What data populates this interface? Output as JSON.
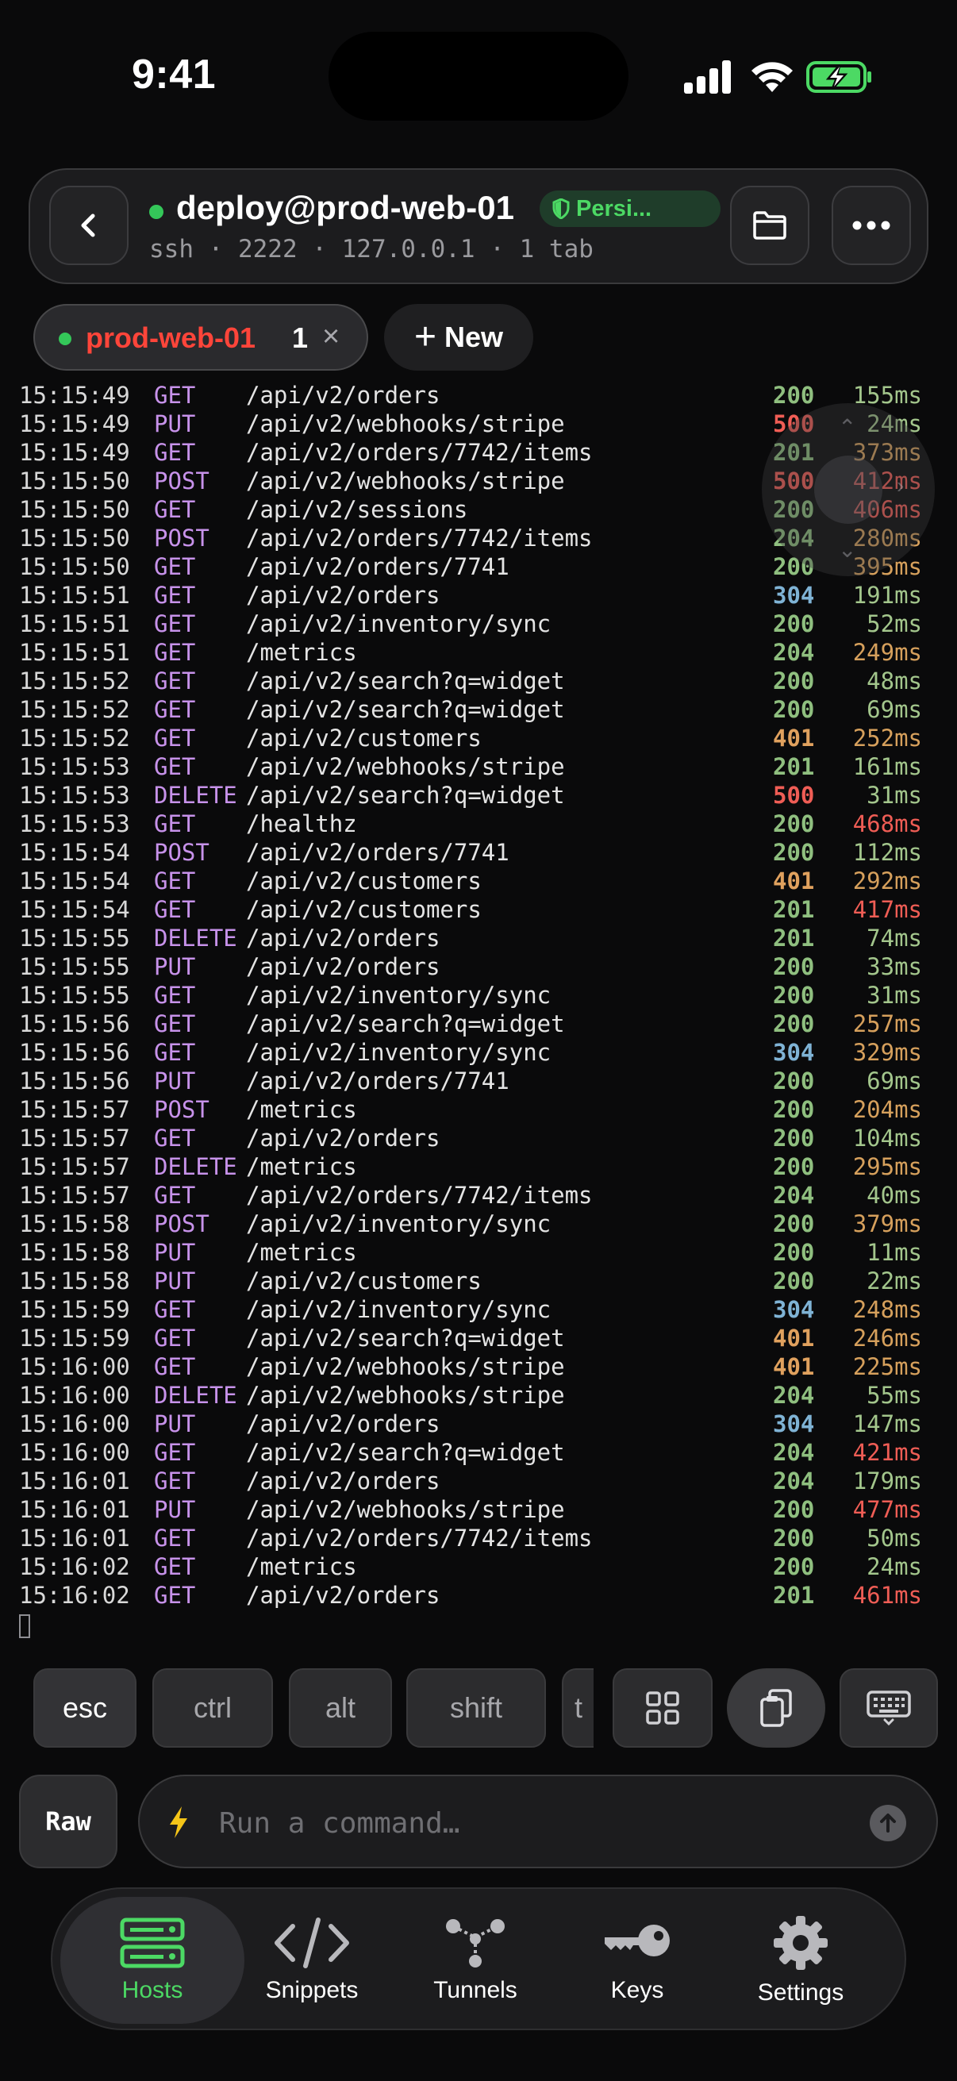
{
  "status_bar": {
    "time": "9:41"
  },
  "header": {
    "host_title": "deploy@prod-web-01",
    "badge": "Persi...",
    "subtitle": "ssh · 2222 · 127.0.0.1 · 1 tab"
  },
  "tabs": {
    "active_tab": {
      "name": "prod-web-01",
      "count": "1",
      "close": "×"
    },
    "new_label": "New"
  },
  "colors": {
    "status_2xx": "#8fbf7f",
    "status_304": "#7fb3d5",
    "status_401": "#e0a15e",
    "status_500": "#ef5d55",
    "dur_fast": "#a3c68c",
    "dur_mid": "#d6a05c",
    "dur_slow": "#ef5d55",
    "accent_green": "#4cd964"
  },
  "log": [
    {
      "t": "15:15:49",
      "m": "GET",
      "p": "/api/v2/orders",
      "s": "200",
      "d": "155ms"
    },
    {
      "t": "15:15:49",
      "m": "PUT",
      "p": "/api/v2/webhooks/stripe",
      "s": "500",
      "d": "24ms"
    },
    {
      "t": "15:15:49",
      "m": "GET",
      "p": "/api/v2/orders/7742/items",
      "s": "201",
      "d": "373ms"
    },
    {
      "t": "15:15:50",
      "m": "POST",
      "p": "/api/v2/webhooks/stripe",
      "s": "500",
      "d": "412ms"
    },
    {
      "t": "15:15:50",
      "m": "GET",
      "p": "/api/v2/sessions",
      "s": "200",
      "d": "406ms"
    },
    {
      "t": "15:15:50",
      "m": "POST",
      "p": "/api/v2/orders/7742/items",
      "s": "204",
      "d": "280ms"
    },
    {
      "t": "15:15:50",
      "m": "GET",
      "p": "/api/v2/orders/7741",
      "s": "200",
      "d": "395ms"
    },
    {
      "t": "15:15:51",
      "m": "GET",
      "p": "/api/v2/orders",
      "s": "304",
      "d": "191ms"
    },
    {
      "t": "15:15:51",
      "m": "GET",
      "p": "/api/v2/inventory/sync",
      "s": "200",
      "d": "52ms"
    },
    {
      "t": "15:15:51",
      "m": "GET",
      "p": "/metrics",
      "s": "204",
      "d": "249ms"
    },
    {
      "t": "15:15:52",
      "m": "GET",
      "p": "/api/v2/search?q=widget",
      "s": "200",
      "d": "48ms"
    },
    {
      "t": "15:15:52",
      "m": "GET",
      "p": "/api/v2/search?q=widget",
      "s": "200",
      "d": "69ms"
    },
    {
      "t": "15:15:52",
      "m": "GET",
      "p": "/api/v2/customers",
      "s": "401",
      "d": "252ms"
    },
    {
      "t": "15:15:53",
      "m": "GET",
      "p": "/api/v2/webhooks/stripe",
      "s": "201",
      "d": "161ms"
    },
    {
      "t": "15:15:53",
      "m": "DELETE",
      "p": "/api/v2/search?q=widget",
      "s": "500",
      "d": "31ms"
    },
    {
      "t": "15:15:53",
      "m": "GET",
      "p": "/healthz",
      "s": "200",
      "d": "468ms"
    },
    {
      "t": "15:15:54",
      "m": "POST",
      "p": "/api/v2/orders/7741",
      "s": "200",
      "d": "112ms"
    },
    {
      "t": "15:15:54",
      "m": "GET",
      "p": "/api/v2/customers",
      "s": "401",
      "d": "292ms"
    },
    {
      "t": "15:15:54",
      "m": "GET",
      "p": "/api/v2/customers",
      "s": "201",
      "d": "417ms"
    },
    {
      "t": "15:15:55",
      "m": "DELETE",
      "p": "/api/v2/orders",
      "s": "201",
      "d": "74ms"
    },
    {
      "t": "15:15:55",
      "m": "PUT",
      "p": "/api/v2/orders",
      "s": "200",
      "d": "33ms"
    },
    {
      "t": "15:15:55",
      "m": "GET",
      "p": "/api/v2/inventory/sync",
      "s": "200",
      "d": "31ms"
    },
    {
      "t": "15:15:56",
      "m": "GET",
      "p": "/api/v2/search?q=widget",
      "s": "200",
      "d": "257ms"
    },
    {
      "t": "15:15:56",
      "m": "GET",
      "p": "/api/v2/inventory/sync",
      "s": "304",
      "d": "329ms"
    },
    {
      "t": "15:15:56",
      "m": "PUT",
      "p": "/api/v2/orders/7741",
      "s": "200",
      "d": "69ms"
    },
    {
      "t": "15:15:57",
      "m": "POST",
      "p": "/metrics",
      "s": "200",
      "d": "204ms"
    },
    {
      "t": "15:15:57",
      "m": "GET",
      "p": "/api/v2/orders",
      "s": "200",
      "d": "104ms"
    },
    {
      "t": "15:15:57",
      "m": "DELETE",
      "p": "/metrics",
      "s": "200",
      "d": "295ms"
    },
    {
      "t": "15:15:57",
      "m": "GET",
      "p": "/api/v2/orders/7742/items",
      "s": "204",
      "d": "40ms"
    },
    {
      "t": "15:15:58",
      "m": "POST",
      "p": "/api/v2/inventory/sync",
      "s": "200",
      "d": "379ms"
    },
    {
      "t": "15:15:58",
      "m": "PUT",
      "p": "/metrics",
      "s": "200",
      "d": "11ms"
    },
    {
      "t": "15:15:58",
      "m": "PUT",
      "p": "/api/v2/customers",
      "s": "200",
      "d": "22ms"
    },
    {
      "t": "15:15:59",
      "m": "GET",
      "p": "/api/v2/inventory/sync",
      "s": "304",
      "d": "248ms"
    },
    {
      "t": "15:15:59",
      "m": "GET",
      "p": "/api/v2/search?q=widget",
      "s": "401",
      "d": "246ms"
    },
    {
      "t": "15:16:00",
      "m": "GET",
      "p": "/api/v2/webhooks/stripe",
      "s": "401",
      "d": "225ms"
    },
    {
      "t": "15:16:00",
      "m": "DELETE",
      "p": "/api/v2/webhooks/stripe",
      "s": "204",
      "d": "55ms"
    },
    {
      "t": "15:16:00",
      "m": "PUT",
      "p": "/api/v2/orders",
      "s": "304",
      "d": "147ms"
    },
    {
      "t": "15:16:00",
      "m": "GET",
      "p": "/api/v2/search?q=widget",
      "s": "204",
      "d": "421ms"
    },
    {
      "t": "15:16:01",
      "m": "GET",
      "p": "/api/v2/orders",
      "s": "204",
      "d": "179ms"
    },
    {
      "t": "15:16:01",
      "m": "PUT",
      "p": "/api/v2/webhooks/stripe",
      "s": "200",
      "d": "477ms"
    },
    {
      "t": "15:16:01",
      "m": "GET",
      "p": "/api/v2/orders/7742/items",
      "s": "200",
      "d": "50ms"
    },
    {
      "t": "15:16:02",
      "m": "GET",
      "p": "/metrics",
      "s": "200",
      "d": "24ms"
    },
    {
      "t": "15:16:02",
      "m": "GET",
      "p": "/api/v2/orders",
      "s": "201",
      "d": "461ms"
    }
  ],
  "keybar": {
    "esc": "esc",
    "ctrl": "ctrl",
    "alt": "alt",
    "shift": "shift",
    "partial": "t"
  },
  "command": {
    "raw_label": "Raw",
    "placeholder": "Run a command…"
  },
  "tabbar": {
    "items": [
      {
        "label": "Hosts",
        "icon": "server-icon",
        "active": true
      },
      {
        "label": "Snippets",
        "icon": "code-icon",
        "active": false
      },
      {
        "label": "Tunnels",
        "icon": "tunnel-nodes-icon",
        "active": false
      },
      {
        "label": "Keys",
        "icon": "key-icon",
        "active": false
      },
      {
        "label": "Settings",
        "icon": "gear-icon",
        "active": false
      }
    ]
  }
}
